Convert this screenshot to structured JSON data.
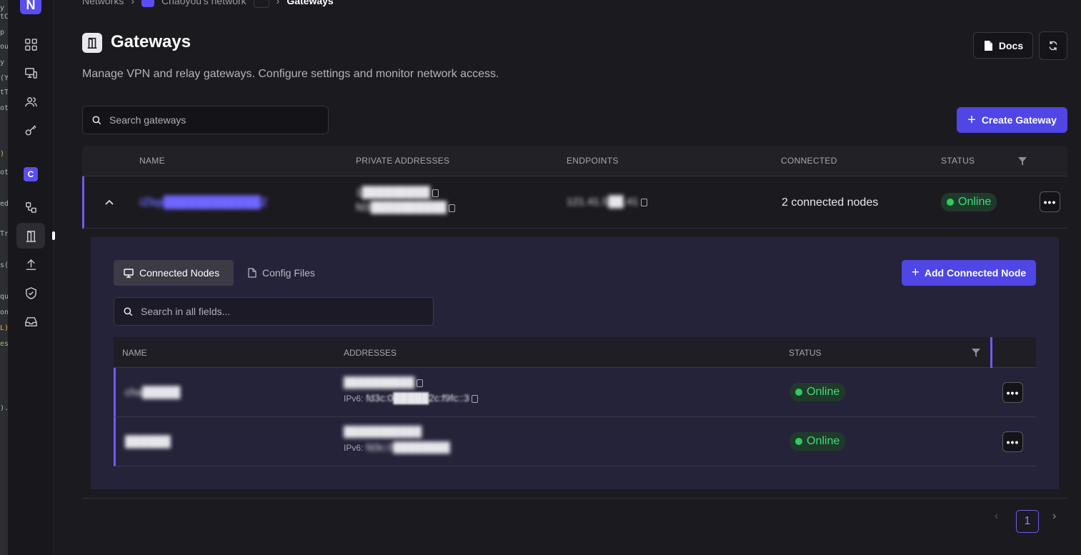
{
  "breadcrumb": {
    "networks": "Networks",
    "network_name": "Chaoyou's network",
    "current": "Gateways"
  },
  "sidebar": {
    "logo": "N",
    "network_badge": "C"
  },
  "header": {
    "title": "Gateways",
    "subtitle": "Manage VPN and relay gateways. Configure settings and monitor network access.",
    "docs_label": "Docs"
  },
  "search": {
    "placeholder": "Search gateways"
  },
  "create_label": "Create Gateway",
  "gateways_table": {
    "columns": [
      "NAME",
      "PRIVATE ADDRESSES",
      "ENDPOINTS",
      "CONNECTED",
      "STATUS"
    ],
    "rows": [
      {
        "name": "iZbp████████████Z",
        "address_v4": "1█████████",
        "address_v6": "fd3██████████",
        "endpoint": "121.41.5██.41",
        "connected": "2 connected nodes",
        "status": "Online"
      }
    ]
  },
  "panel": {
    "tab_nodes": "Connected Nodes",
    "tab_config": "Config Files",
    "add_node_label": "Add Connected Node",
    "search_placeholder": "Search in all fields...",
    "columns": [
      "NAME",
      "ADDRESSES",
      "STATUS"
    ],
    "ipv6_label": "IPv6:",
    "rows": [
      {
        "name": "cha█████",
        "address_v4": "██████████",
        "address_v6": "fd3c:0█████2c:f9fc::3",
        "status": "Online"
      },
      {
        "name": "██████",
        "address_v4": "███████████",
        "address_v6": "fd3c:0████████",
        "status": "Online"
      }
    ]
  },
  "pagination": {
    "current": "1"
  },
  "colors": {
    "accent": "#4f46e5",
    "online": "#3fdc7a",
    "row_marker": "#6d5cf0"
  }
}
